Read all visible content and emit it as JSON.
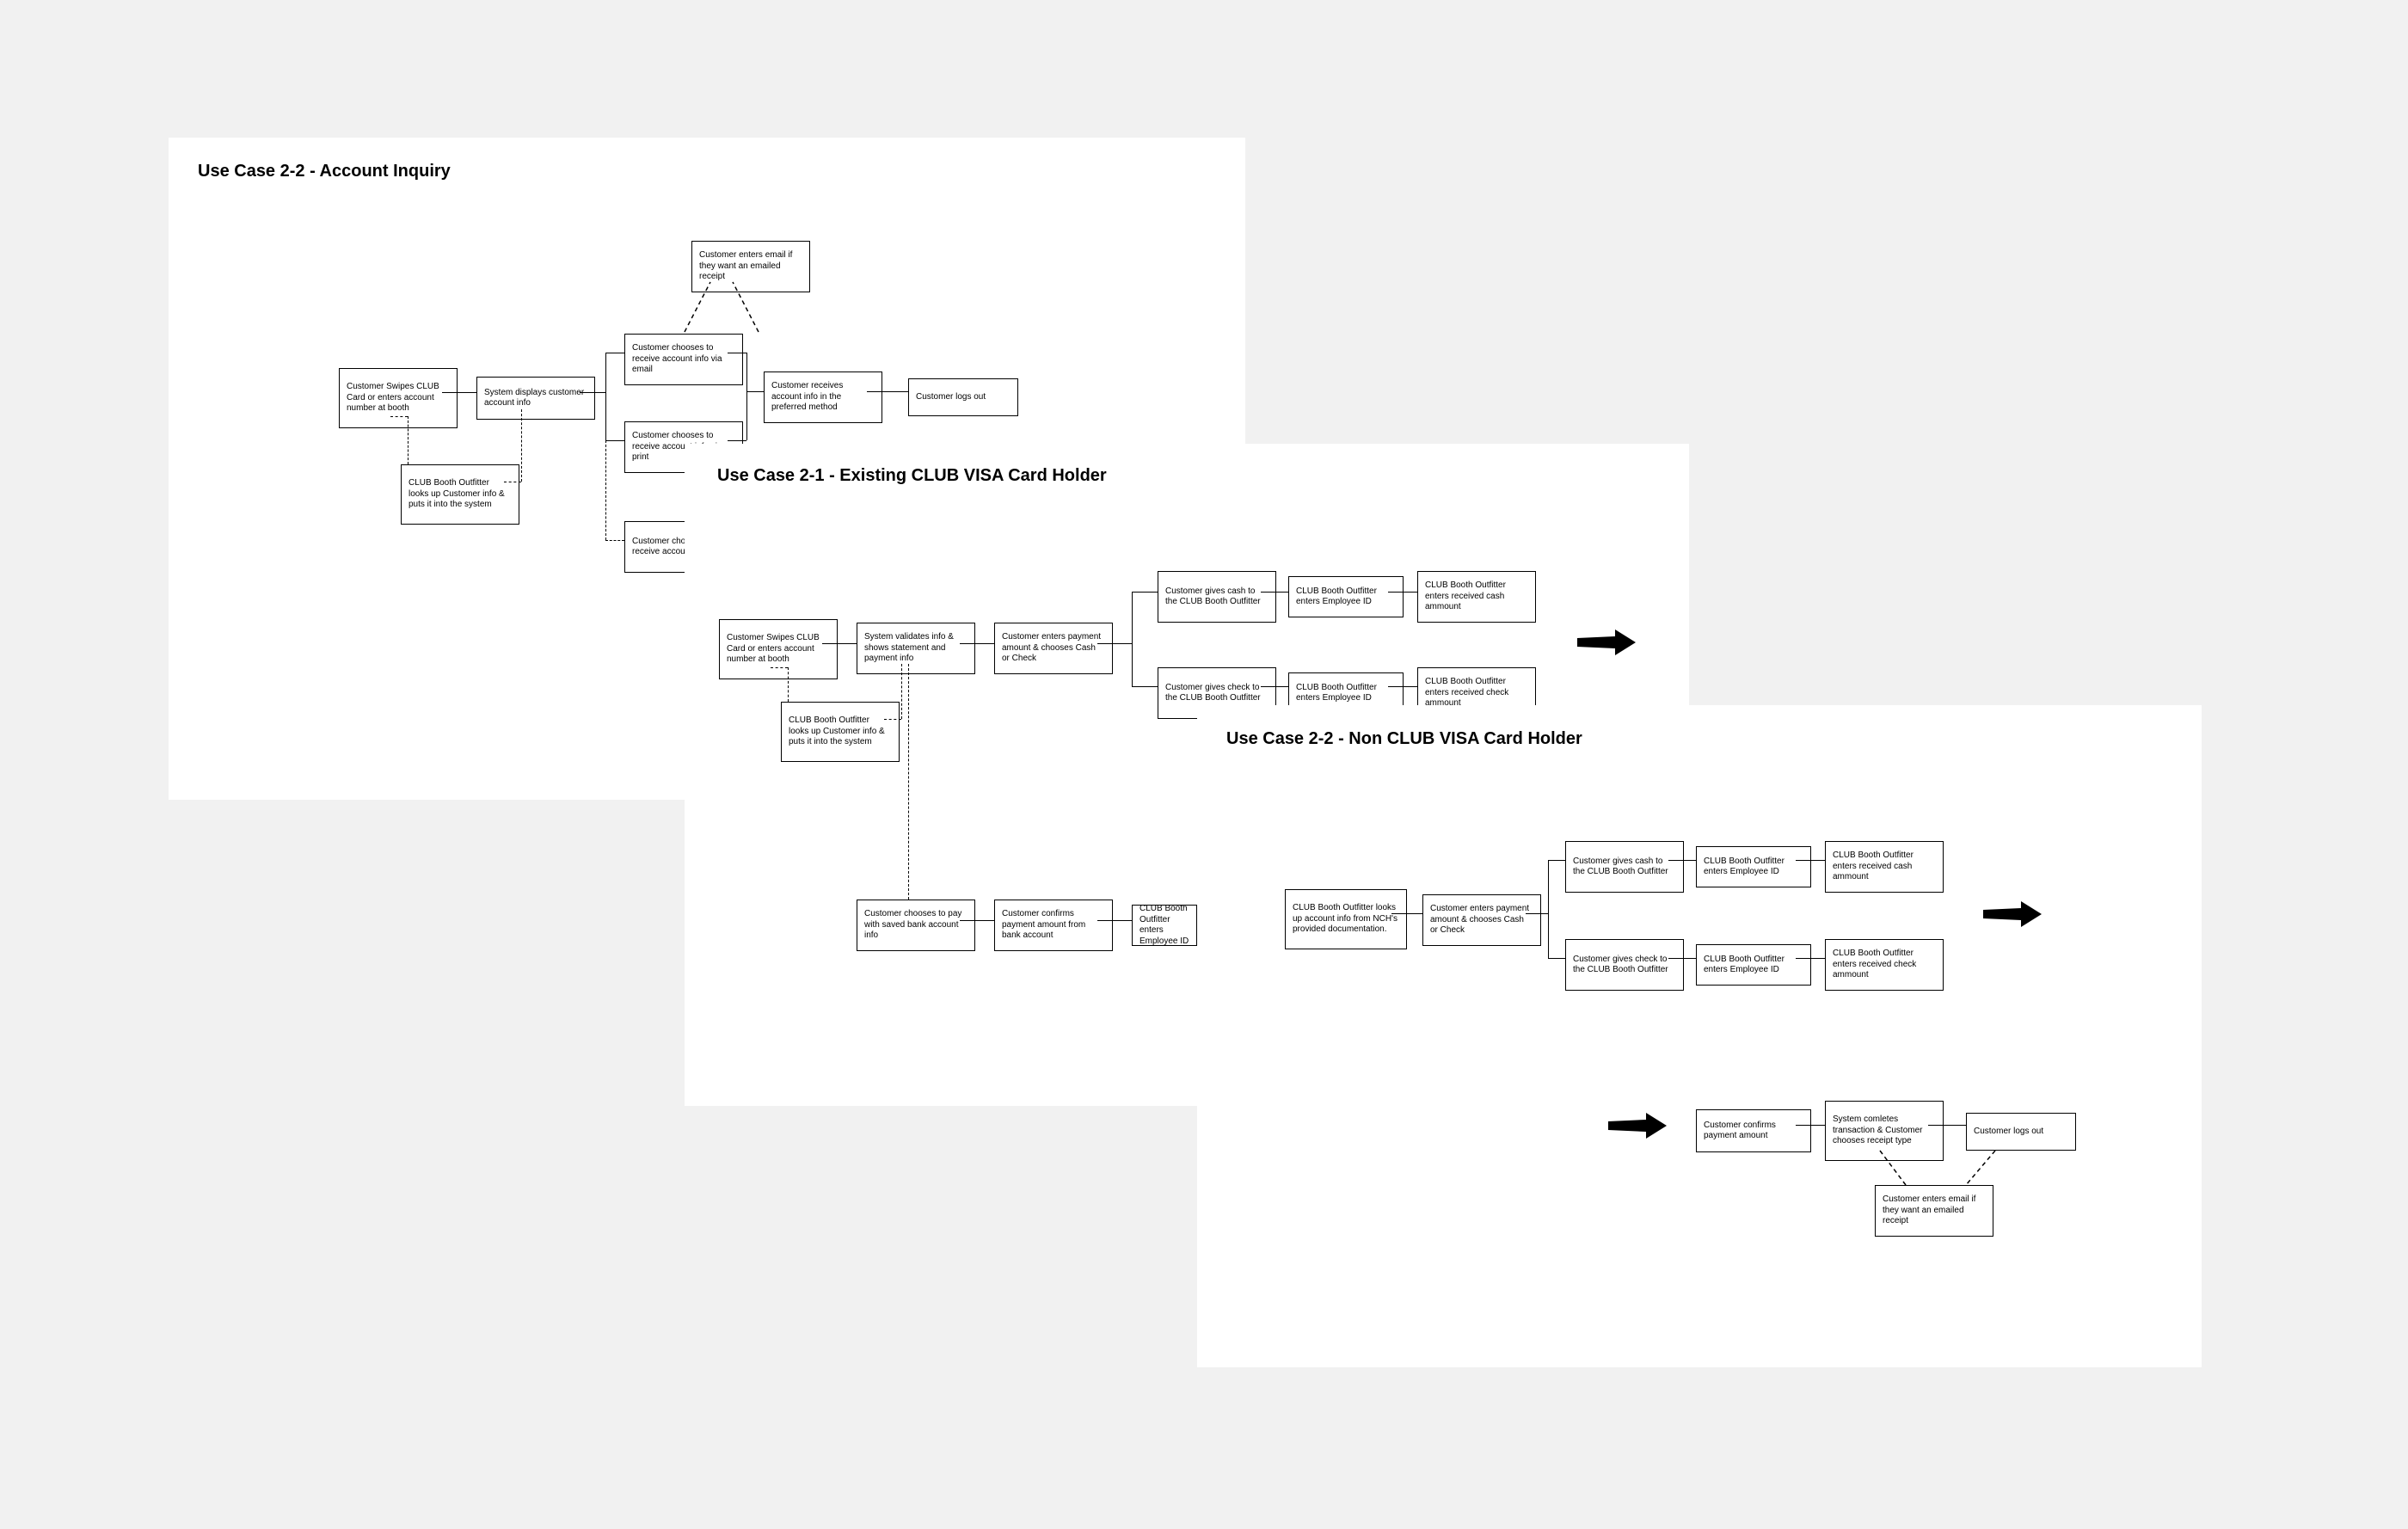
{
  "panel_a": {
    "title": "Use Case 2-2 - Account Inquiry",
    "nodes": {
      "a1": "Customer Swipes CLUB Card or enters account number at booth",
      "a1b": "CLUB Booth Outfitter looks up Customer info & puts it into the system",
      "a2": "System displays customer account info",
      "a3": "Customer chooses to receive account info via email",
      "a3b": "Customer enters email if they want an emailed receipt",
      "a4": "Customer chooses to receive account info via print",
      "a5": "Customer chooses not to receive account info",
      "a6": "Customer receives account info in the preferred method",
      "a7": "Customer logs out"
    }
  },
  "panel_b": {
    "title": "Use Case 2-1 - Existing CLUB VISA Card Holder",
    "nodes": {
      "b1": "Customer Swipes CLUB Card or enters account number at booth",
      "b1b": "CLUB Booth Outfitter looks up Customer info & puts it into the system",
      "b2": "System validates info & shows statement and payment info",
      "b3": "Customer enters payment amount & chooses Cash or Check",
      "b4a": "Customer gives cash to the CLUB Booth Outfitter",
      "b5a": "CLUB Booth Outfitter enters Employee ID",
      "b6a": "CLUB Booth Outfitter enters received cash ammount",
      "b4b": "Customer gives check to the CLUB Booth Outfitter",
      "b5b": "CLUB Booth Outfitter enters Employee ID",
      "b6b": "CLUB Booth Outfitter enters received check ammount",
      "b7": "Customer chooses to pay with saved bank account info",
      "b8": "Customer confirms payment amount from bank account",
      "b9": "CLUB Booth Outfitter enters Employee ID"
    }
  },
  "panel_c": {
    "title": "Use Case 2-2 - Non CLUB VISA Card Holder",
    "nodes": {
      "c1": "CLUB Booth Outfitter looks up account info from NCH's provided documentation.",
      "c2": "Customer enters payment amount & chooses Cash or Check",
      "c3a": "Customer gives cash to the CLUB Booth Outfitter",
      "c4a": "CLUB Booth Outfitter enters Employee ID",
      "c5a": "CLUB Booth Outfitter enters received cash ammount",
      "c3b": "Customer gives check to the CLUB Booth Outfitter",
      "c4b": "CLUB Booth Outfitter enters Employee ID",
      "c5b": "CLUB Booth Outfitter enters received check ammount",
      "c6": "Customer confirms payment amount",
      "c7": "System comletes transaction & Customer chooses receipt type",
      "c8": "Customer logs out",
      "c9": "Customer enters email if they want an emailed receipt"
    }
  }
}
